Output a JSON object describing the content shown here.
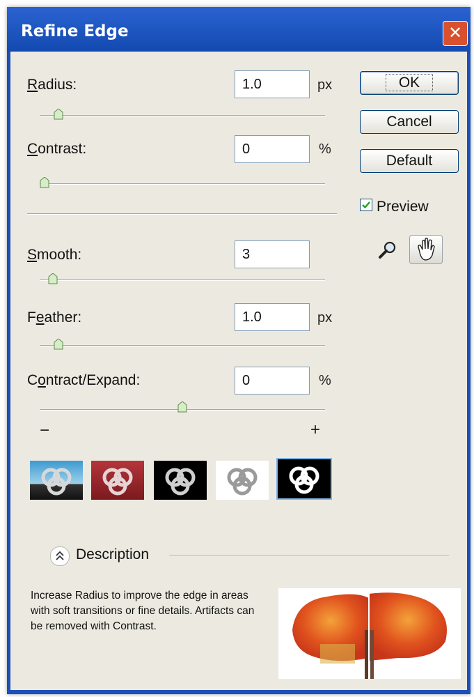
{
  "window": {
    "title": "Refine Edge",
    "close_glyph": "✕"
  },
  "controls": {
    "radius": {
      "label_pre": "",
      "label_key": "R",
      "label_post": "adius:",
      "value": "1.0",
      "unit": "px",
      "slider_fraction": 0.05
    },
    "contrast": {
      "label_pre": "",
      "label_key": "C",
      "label_post": "ontrast:",
      "value": "0",
      "unit": "%",
      "slider_fraction": 0.0
    },
    "smooth": {
      "label_pre": "",
      "label_key": "S",
      "label_post": "mooth:",
      "value": "3",
      "unit": "",
      "slider_fraction": 0.03
    },
    "feather": {
      "label_pre": "F",
      "label_key": "e",
      "label_post": "ather:",
      "value": "1.0",
      "unit": "px",
      "slider_fraction": 0.05
    },
    "contract_expand": {
      "label_pre": "C",
      "label_key": "o",
      "label_post": "ntract/Expand:",
      "value": "0",
      "unit": "%",
      "slider_fraction": 0.5,
      "min_label": "−",
      "max_label": "+"
    }
  },
  "buttons": {
    "ok": "OK",
    "cancel": "Cancel",
    "default": "Default"
  },
  "preview": {
    "label": "Preview",
    "checked": true
  },
  "tools": [
    "zoom-icon",
    "hand-icon"
  ],
  "view_modes": [
    "standard",
    "overlay",
    "on-black",
    "on-white",
    "mask"
  ],
  "selected_view_mode": 4,
  "description": {
    "title": "Description",
    "text": "Increase Radius to improve the edge in areas with soft transitions or fine details. Artifacts can be removed with Contrast."
  },
  "colors": {
    "titlebar": "#1c4fb7",
    "panel": "#eceae0",
    "accent": "#316ac5",
    "close": "#d9502c"
  }
}
